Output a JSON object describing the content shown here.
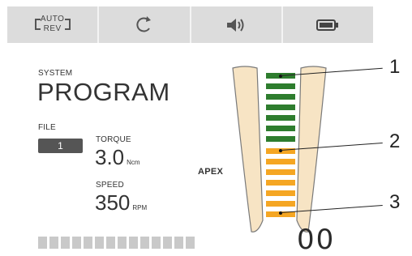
{
  "status_bar": {
    "auto_rev": {
      "line1": "AUTO",
      "line2": "REV"
    },
    "icons": [
      "auto-reverse-icon",
      "rotation-icon",
      "speaker-icon",
      "battery-icon"
    ]
  },
  "system": {
    "label": "SYSTEM",
    "value": "PROGRAM"
  },
  "file": {
    "label": "FILE",
    "value": "1"
  },
  "torque": {
    "label": "TORQUE",
    "value": "3.0",
    "unit": "Ncm"
  },
  "speed": {
    "label": "SPEED",
    "value": "350",
    "unit": "RPM"
  },
  "apex_label": "APEX",
  "markers": [
    "1",
    "2",
    "3"
  ],
  "gauge": {
    "green_bars": 7,
    "orange_bars": 7,
    "colors": {
      "green": "#2e7d2e",
      "orange": "#f5a623"
    }
  },
  "counter": "00",
  "segment_bar": {
    "segments": 14
  }
}
